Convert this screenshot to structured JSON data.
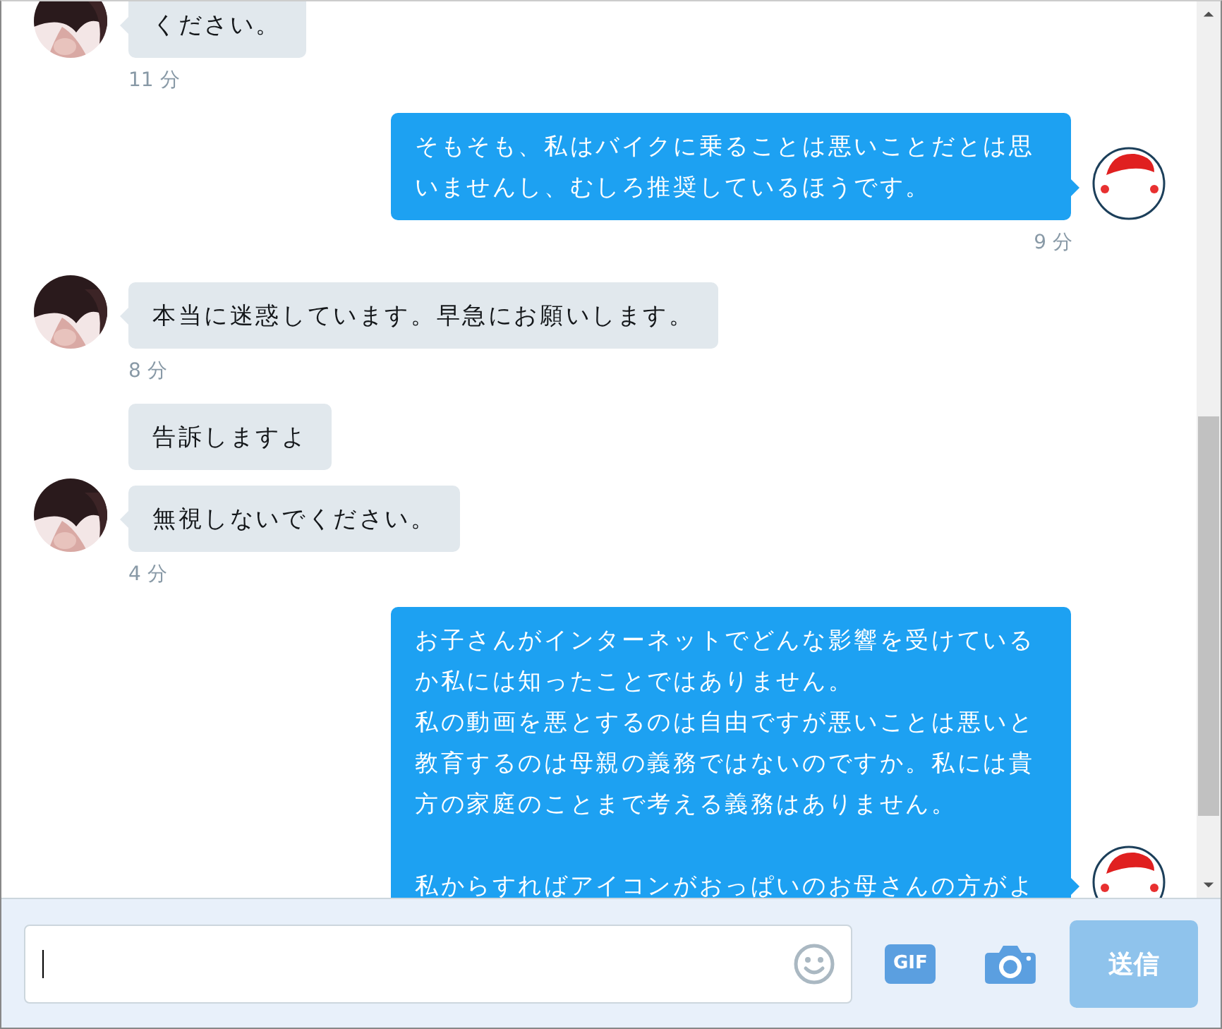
{
  "messages": [
    {
      "kind": "received",
      "bubbles": [
        [
          [
            "ください。"
          ]
        ]
      ],
      "time": "11 分"
    },
    {
      "kind": "sent",
      "bubbles": [
        [
          [
            "そもそも、私はバイクに乗ることは悪いことだとは思いませんし、むしろ推奨しているほうです。"
          ]
        ]
      ],
      "time": "9 分"
    },
    {
      "kind": "received",
      "bubbles": [
        [
          [
            "本当に迷惑しています。早急にお願いします。"
          ]
        ]
      ],
      "time": "8 分"
    },
    {
      "kind": "received",
      "bubbles": [
        [
          [
            "告訴しますよ"
          ]
        ],
        [
          [
            "無視しないでください。"
          ]
        ]
      ],
      "time": "4 分"
    },
    {
      "kind": "sent",
      "bubbles": [
        [
          [
            "お子さんがインターネットでどんな影響を受けているか私には知ったことではありません。",
            "私の動画を悪とするのは自由ですが悪いことは悪いと教育するのは母親の義務ではないのですか。私には貴方の家庭のことまで考える義務はありません。"
          ],
          [
            "私からすればアイコンがおっぱいのお母さんの方がよ"
          ]
        ]
      ]
    }
  ],
  "composer": {
    "gif_label": "GIF",
    "send_button": {
      "label": "送信",
      "disabled": true
    }
  }
}
